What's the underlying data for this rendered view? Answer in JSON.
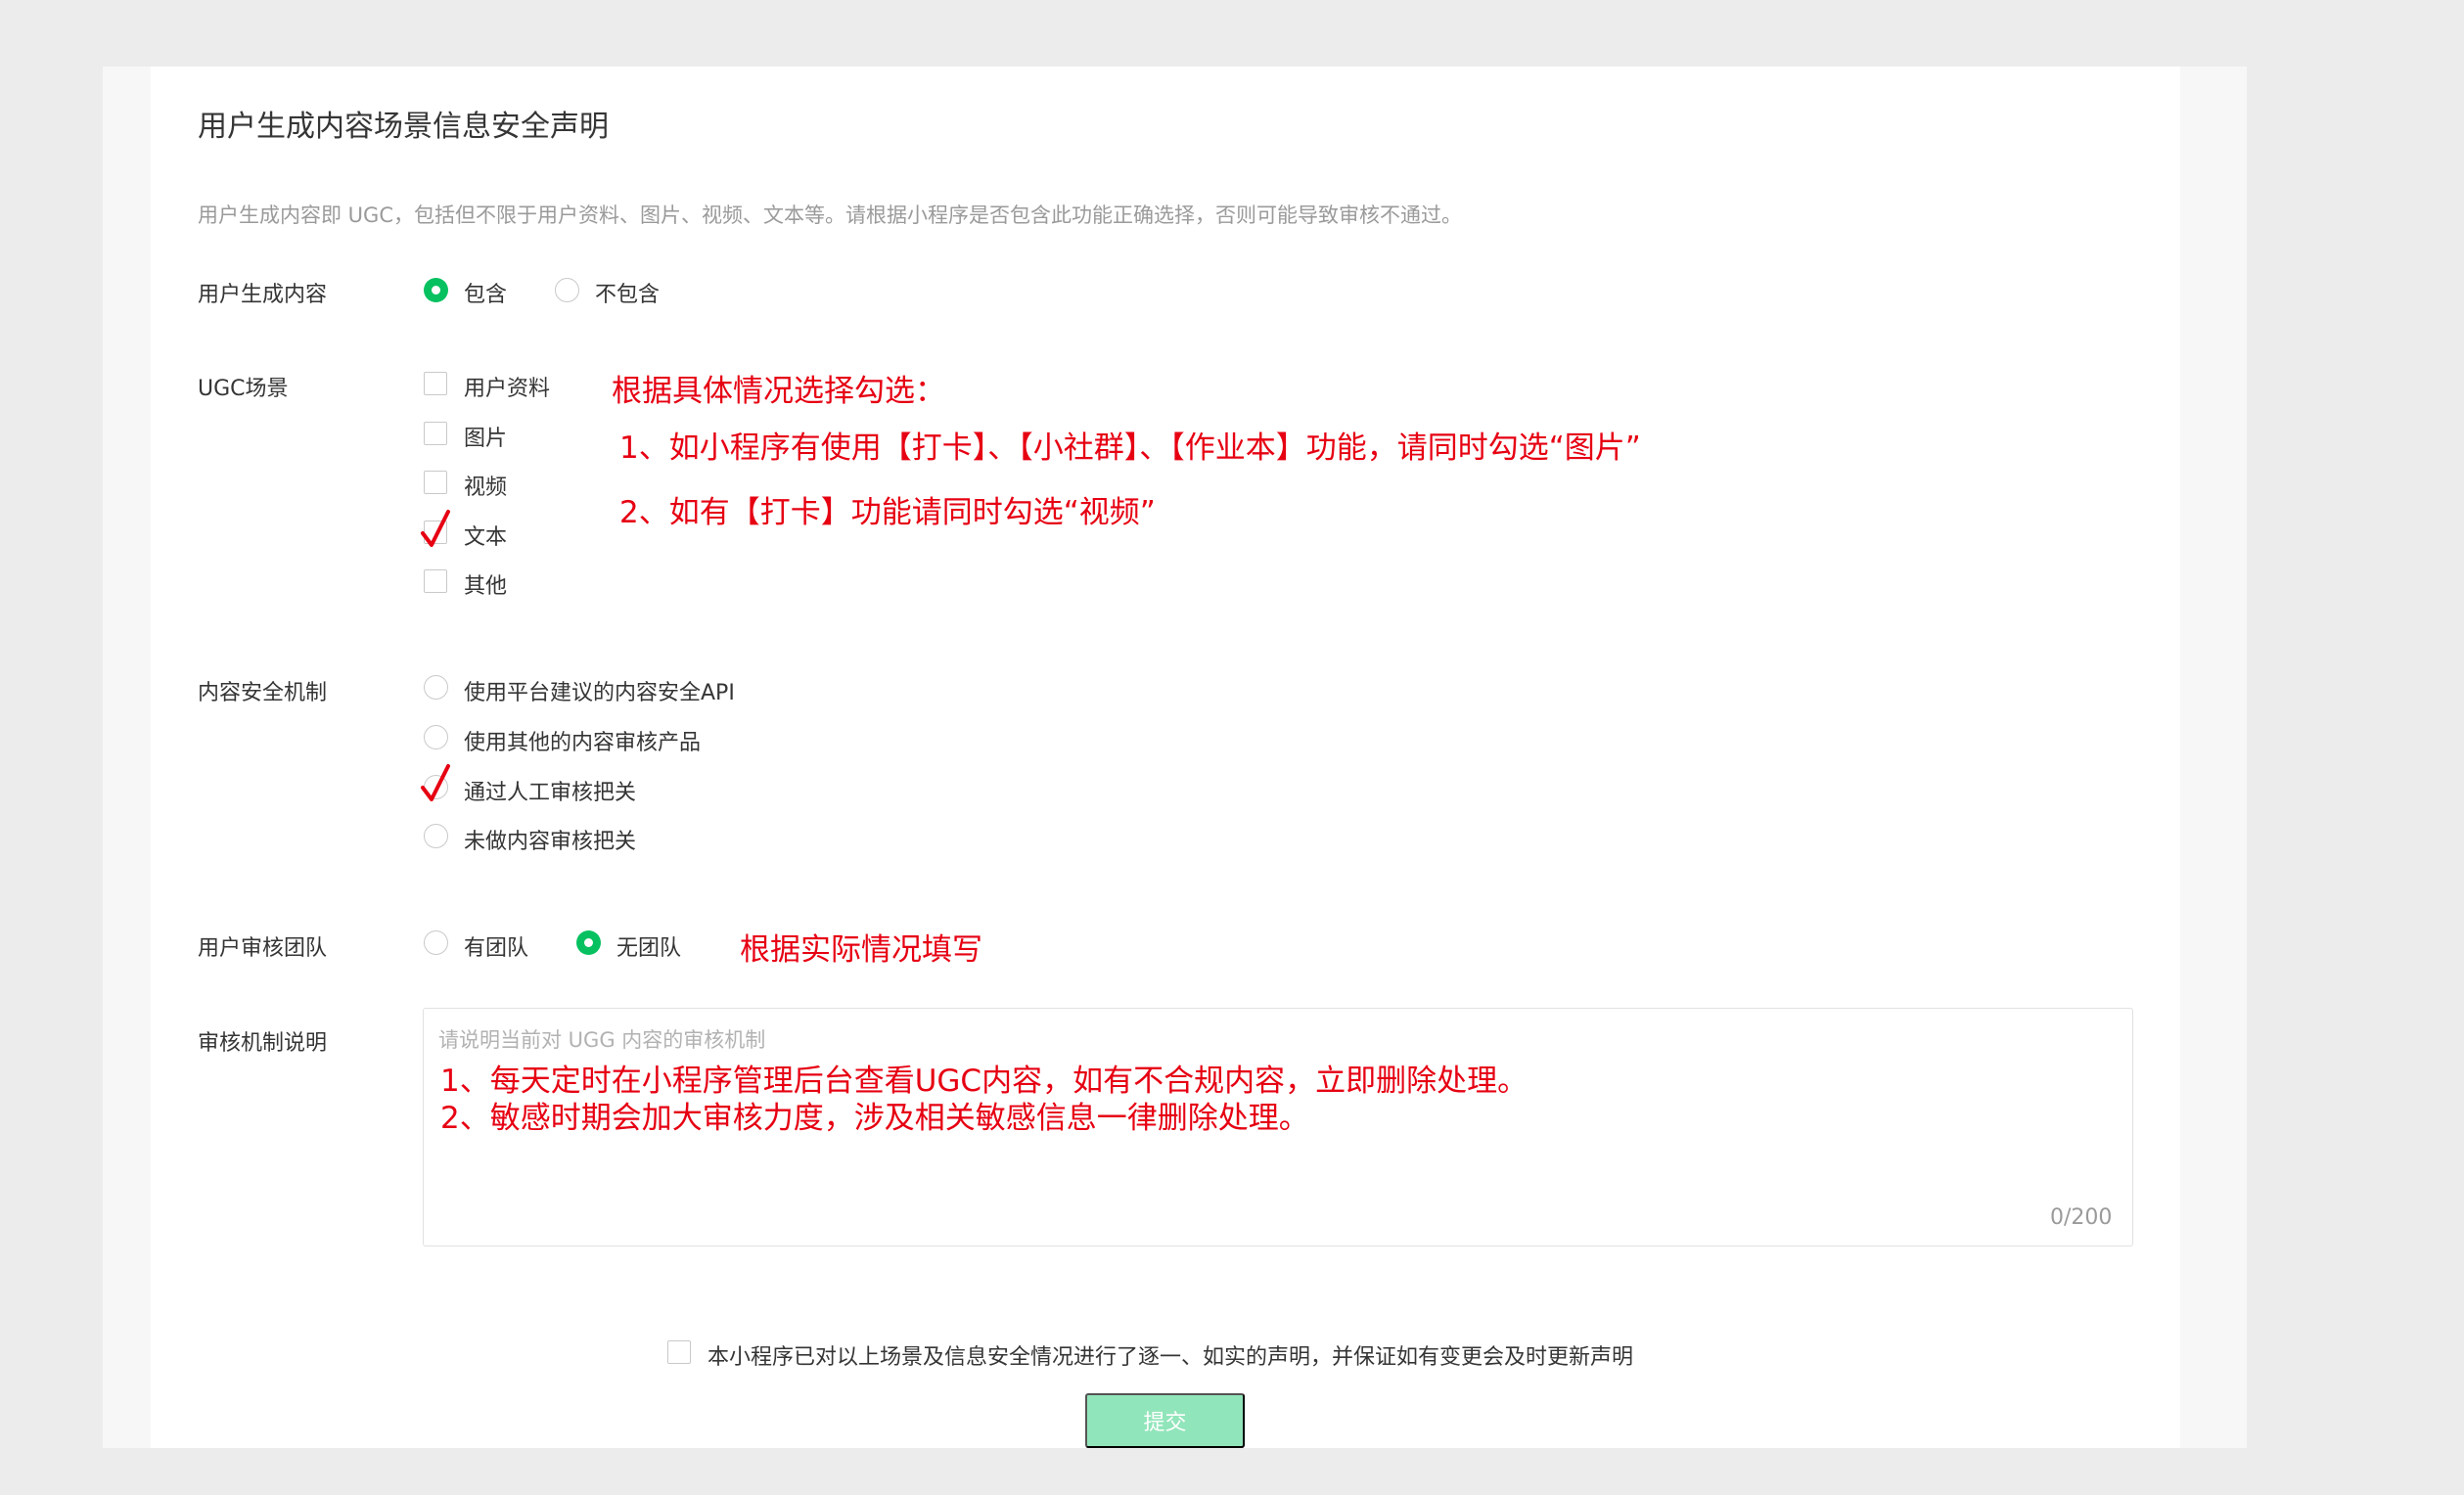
{
  "page": {
    "title": "用户生成内容场景信息安全声明",
    "description": "用户生成内容即 UGC，包括但不限于用户资料、图片、视频、文本等。请根据小程序是否包含此功能正确选择，否则可能导致审核不通过。"
  },
  "ugc_content": {
    "label": "用户生成内容",
    "options": [
      {
        "label": "包含",
        "selected": true
      },
      {
        "label": "不包含",
        "selected": false
      }
    ]
  },
  "ugc_scene": {
    "label": "UGC场景",
    "options": [
      {
        "label": "用户资料",
        "checked": false
      },
      {
        "label": "图片",
        "checked": false
      },
      {
        "label": "视频",
        "checked": false
      },
      {
        "label": "文本",
        "checked": true
      },
      {
        "label": "其他",
        "checked": false
      }
    ],
    "annotation": {
      "heading": "根据具体情况选择勾选：",
      "line1": "1、如小程序有使用【打卡】、【小社群】、【作业本】功能，请同时勾选“图片”",
      "line2": "2、如有【打卡】功能请同时勾选“视频”"
    }
  },
  "safety_mechanism": {
    "label": "内容安全机制",
    "options": [
      {
        "label": "使用平台建议的内容安全API",
        "selected": false
      },
      {
        "label": "使用其他的内容审核产品",
        "selected": false
      },
      {
        "label": "通过人工审核把关",
        "selected": true
      },
      {
        "label": "未做内容审核把关",
        "selected": false
      }
    ]
  },
  "review_team": {
    "label": "用户审核团队",
    "options": [
      {
        "label": "有团队",
        "selected": false
      },
      {
        "label": "无团队",
        "selected": true
      }
    ],
    "annotation": "根据实际情况填写"
  },
  "review_description": {
    "label": "审核机制说明",
    "placeholder": "请说明当前对 UGG 内容的审核机制",
    "content_line1": "1、每天定时在小程序管理后台查看UGC内容，如有不合规内容，立即删除处理。",
    "content_line2": "2、敏感时期会加大审核力度，涉及相关敏感信息一律删除处理。",
    "counter": "0/200"
  },
  "declaration": {
    "text": "本小程序已对以上场景及信息安全情况进行了逐一、如实的声明，并保证如有变更会及时更新声明",
    "checked": false
  },
  "submit": {
    "label": "提交"
  },
  "colors": {
    "accent": "#07c160",
    "annotation": "#e60012",
    "submit_disabled": "#91e5ba"
  }
}
